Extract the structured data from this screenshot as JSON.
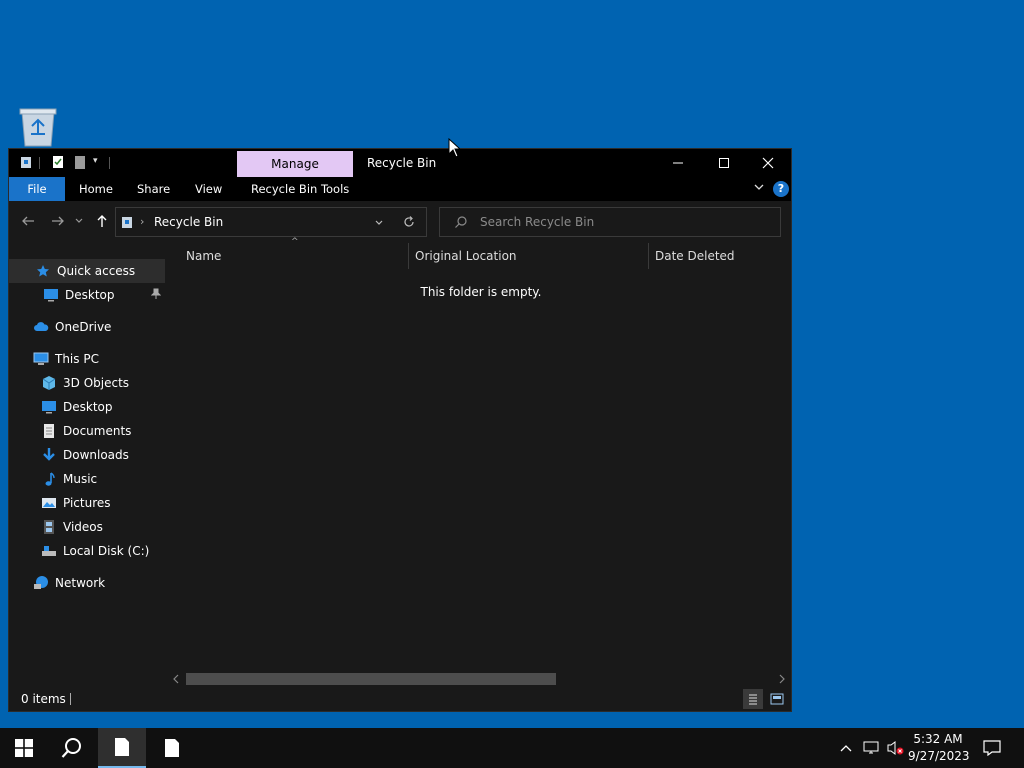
{
  "desktop": {
    "recycle_bin_icon": "recycle-bin-icon"
  },
  "window": {
    "title": "Recycle Bin",
    "manage_tab": "Manage",
    "ribbon_tabs": [
      "File",
      "Home",
      "Share",
      "View",
      "Recycle Bin Tools"
    ],
    "address": "Recycle Bin",
    "search_placeholder": "Search Recycle Bin",
    "columns": [
      "Name",
      "Original Location",
      "Date Deleted"
    ],
    "empty_message": "This folder is empty.",
    "status": "0 items"
  },
  "nav": {
    "quick_access": "Quick access",
    "quick_desktop": "Desktop",
    "onedrive": "OneDrive",
    "this_pc": "This PC",
    "items": [
      "3D Objects",
      "Desktop",
      "Documents",
      "Downloads",
      "Music",
      "Pictures",
      "Videos",
      "Local Disk (C:)"
    ],
    "network": "Network"
  },
  "taskbar": {
    "time": "5:32 AM",
    "date": "9/27/2023"
  },
  "colors": {
    "desktop": "#0063b1",
    "window_bg": "#191919",
    "accent": "#1a73c9",
    "manage_tab": "#e3c8f4"
  }
}
